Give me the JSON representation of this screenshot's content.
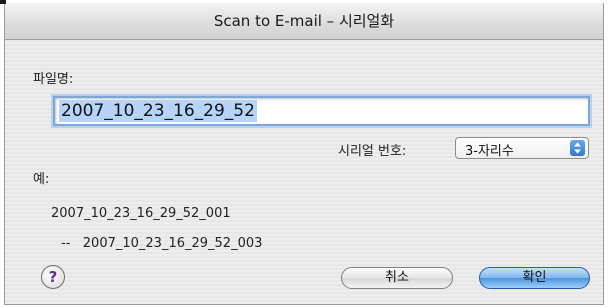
{
  "window": {
    "title": "Scan to E-mail – 시리얼화"
  },
  "filename": {
    "label": "파일명:",
    "value": "2007_10_23_16_29_52"
  },
  "serial": {
    "label": "시리얼 번호:",
    "selected": "3-자리수"
  },
  "example": {
    "label": "예:",
    "first": "2007_10_23_16_29_52_001",
    "second": "--   2007_10_23_16_29_52_003"
  },
  "buttons": {
    "help": "?",
    "cancel": "취소",
    "ok": "확인"
  },
  "colors": {
    "focus_ring": "#7ea6d6",
    "text_selection": "#b5d4f8",
    "default_button": "#4d93e0",
    "help_glyph": "#6a2c91"
  }
}
